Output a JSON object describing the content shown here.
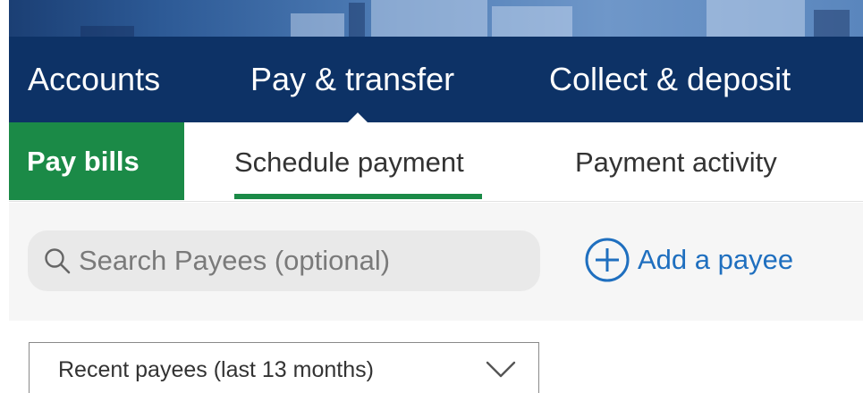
{
  "top_nav": {
    "items": [
      {
        "label": "Accounts"
      },
      {
        "label": "Pay & transfer",
        "active": true
      },
      {
        "label": "Collect & deposit"
      }
    ]
  },
  "sub_nav": {
    "section_label": "Pay bills",
    "tabs": [
      {
        "label": "Schedule payment",
        "active": true
      },
      {
        "label": "Payment activity"
      }
    ]
  },
  "search": {
    "placeholder": "Search Payees (optional)",
    "value": "",
    "icon": "search-icon"
  },
  "add_payee": {
    "label": "Add a payee",
    "icon": "plus-circle-icon"
  },
  "payee_filter": {
    "selected": "Recent payees (last 13 months)",
    "icon": "chevron-down-icon"
  },
  "colors": {
    "nav_background": "#0d3266",
    "section_green": "#1b8a47",
    "link_blue": "#1f6fbf",
    "search_background": "#e9e9e9"
  }
}
